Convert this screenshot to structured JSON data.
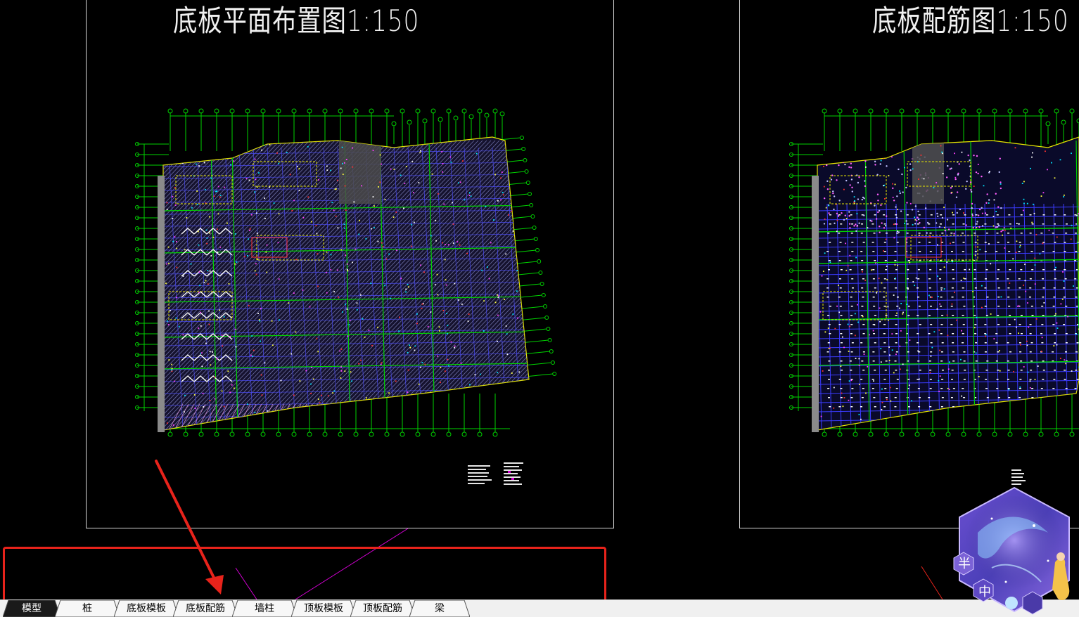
{
  "drawing": {
    "left_sheet_title": "底板平面布置图1:150",
    "right_sheet_title": "底板配筋图1:150"
  },
  "layout_tabs": [
    {
      "label": "模型",
      "active": true
    },
    {
      "label": "桩",
      "active": false
    },
    {
      "label": "底板模板",
      "active": false
    },
    {
      "label": "底板配筋",
      "active": false
    },
    {
      "label": "墙柱",
      "active": false
    },
    {
      "label": "顶板模板",
      "active": false
    },
    {
      "label": "顶板配筋",
      "active": false
    },
    {
      "label": "梁",
      "active": false
    }
  ],
  "badge": {
    "glyph_1": "半",
    "glyph_2": "中"
  },
  "colors": {
    "canvas_bg": "#000000",
    "grid_green": "#00d400",
    "frame_white": "#d8d8d8",
    "annotation_red": "#e8231b",
    "guide_magenta": "#d400d4",
    "tab_active_bg": "#1a1a1a"
  }
}
